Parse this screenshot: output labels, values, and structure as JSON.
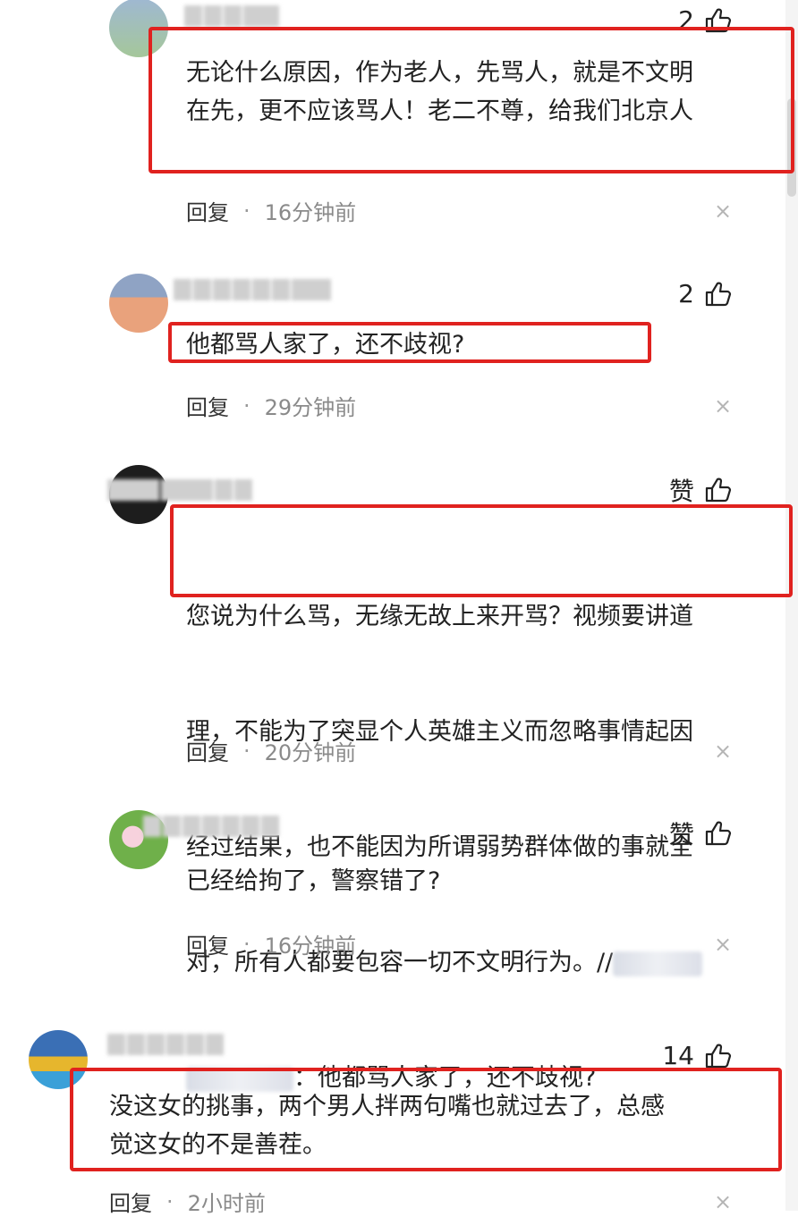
{
  "colors": {
    "highlight_box": "#e0221f",
    "meta_text": "#8a8a8a"
  },
  "comments": [
    {
      "likes": "2",
      "text": "无论什么原因，作为老人，先骂人，就是不文明\n在先，更不应该骂人！老二不尊，给我们北京人",
      "reply": "回复",
      "dot": "·",
      "time": "16分钟前",
      "close": "×"
    },
    {
      "likes": "2",
      "text": "他都骂人家了，还不歧视?",
      "reply": "回复",
      "dot": "·",
      "time": "29分钟前",
      "close": "×"
    },
    {
      "likes": "赞",
      "text_lines": [
        "您说为什么骂，无缘无故上来开骂？视频要讲道",
        "理，不能为了突显个人英雄主义而忽略事情起因",
        "经过结果，也不能因为所谓弱势群体做的事就全",
        "对，所有人都要包容一切不文明行为。//"
      ],
      "quote": "：他都骂人家了，还不歧视?",
      "reply": "回复",
      "dot": "·",
      "time": "20分钟前",
      "close": "×"
    },
    {
      "likes": "赞",
      "text": "已经给拘了，警察错了?",
      "reply": "回复",
      "dot": "·",
      "time": "16分钟前",
      "close": "×"
    },
    {
      "likes": "14",
      "text": "没这女的挑事，两个男人拌两句嘴也就过去了，总感\n觉这女的不是善茬。",
      "reply": "回复",
      "dot": "·",
      "time": "2小时前",
      "close": "×"
    }
  ]
}
